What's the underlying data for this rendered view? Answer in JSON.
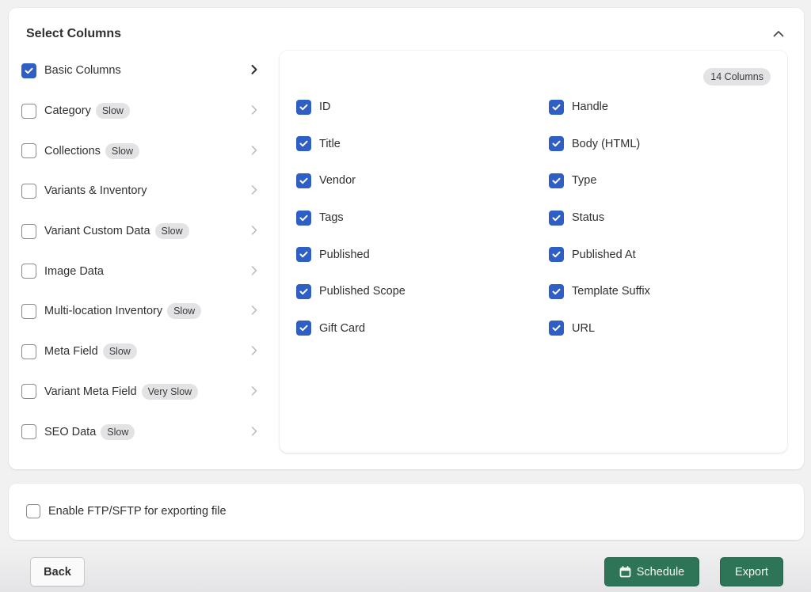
{
  "section": {
    "title": "Select Columns",
    "collapse_icon": "chevron-up-icon"
  },
  "categories": [
    {
      "label": "Basic Columns",
      "checked": true,
      "badge": null,
      "active": true
    },
    {
      "label": "Category",
      "checked": false,
      "badge": "Slow"
    },
    {
      "label": "Collections",
      "checked": false,
      "badge": "Slow"
    },
    {
      "label": "Variants & Inventory",
      "checked": false,
      "badge": null
    },
    {
      "label": "Variant Custom Data",
      "checked": false,
      "badge": "Slow"
    },
    {
      "label": "Image Data",
      "checked": false,
      "badge": null
    },
    {
      "label": "Multi-location Inventory",
      "checked": false,
      "badge": "Slow"
    },
    {
      "label": "Meta Field",
      "checked": false,
      "badge": "Slow"
    },
    {
      "label": "Variant Meta Field",
      "checked": false,
      "badge": "Very Slow"
    },
    {
      "label": "SEO Data",
      "checked": false,
      "badge": "Slow"
    }
  ],
  "columns_panel": {
    "count_label": "14 Columns",
    "columns": [
      {
        "label": "ID",
        "checked": true
      },
      {
        "label": "Handle",
        "checked": true
      },
      {
        "label": "Title",
        "checked": true
      },
      {
        "label": "Body (HTML)",
        "checked": true
      },
      {
        "label": "Vendor",
        "checked": true
      },
      {
        "label": "Type",
        "checked": true
      },
      {
        "label": "Tags",
        "checked": true
      },
      {
        "label": "Status",
        "checked": true
      },
      {
        "label": "Published",
        "checked": true
      },
      {
        "label": "Published At",
        "checked": true
      },
      {
        "label": "Published Scope",
        "checked": true
      },
      {
        "label": "Template Suffix",
        "checked": true
      },
      {
        "label": "Gift Card",
        "checked": true
      },
      {
        "label": "URL",
        "checked": true
      }
    ]
  },
  "ftp": {
    "label": "Enable FTP/SFTP for exporting file",
    "checked": false
  },
  "footer": {
    "back_label": "Back",
    "schedule_label": "Schedule",
    "schedule_icon": "calendar-icon",
    "export_label": "Export"
  },
  "colors": {
    "checkbox_checked": "#2f5fc4",
    "primary_button": "#2d7556",
    "badge_bg": "#e3e3e5",
    "page_bg": "#f1f1f2"
  }
}
